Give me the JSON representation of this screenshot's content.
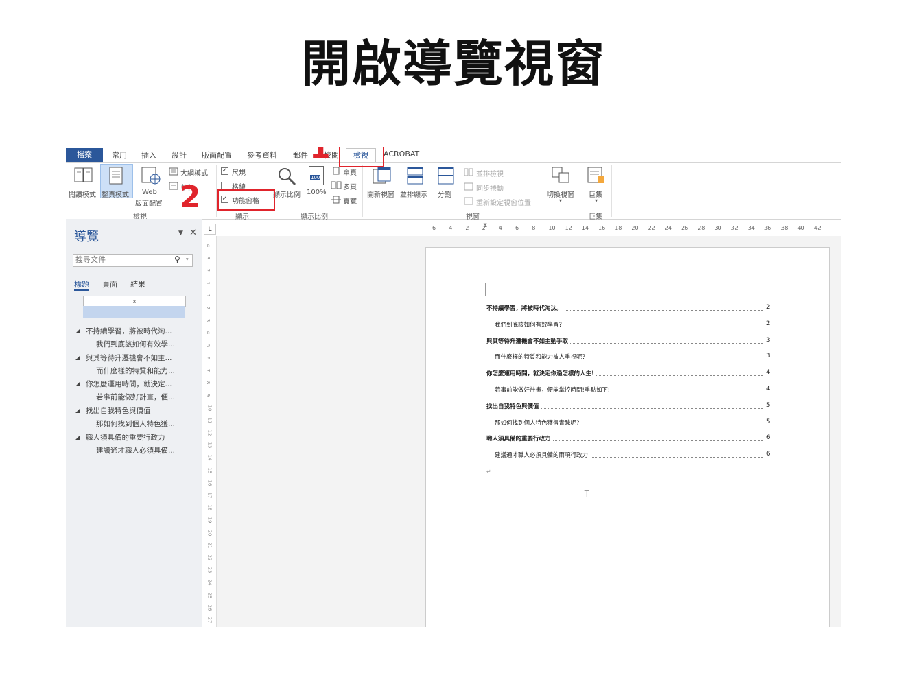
{
  "slide": {
    "title": "開啟導覽視窗"
  },
  "callouts": {
    "step1": "1",
    "step2": "2"
  },
  "tabs": [
    "檔案",
    "常用",
    "插入",
    "設計",
    "版面配置",
    "參考資料",
    "郵件",
    "校閱",
    "檢視",
    "ACROBAT"
  ],
  "ribbon": {
    "views": {
      "read_mode": "閱讀模式",
      "print_layout": "整頁模式",
      "web_layout_1": "Web",
      "web_layout_2": "版面配置",
      "outline": "大綱模式",
      "draft": "草稿",
      "group": "檢視"
    },
    "show": {
      "ruler": "尺規",
      "gridlines": "格線",
      "nav_pane": "功能窗格",
      "group": "顯示"
    },
    "zoom": {
      "zoom": "顯示比例",
      "hundred": "100%",
      "icon_text": "100",
      "one_page": "單頁",
      "multi_page": "多頁",
      "page_width": "頁寬",
      "group": "顯示比例"
    },
    "window": {
      "new_window": "開新視窗",
      "arrange_all": "並排顯示",
      "split": "分割",
      "side_by_side": "並排檢視",
      "sync_scroll": "同步捲動",
      "reset_pos": "重新設定視窗位置",
      "switch": "切換視窗",
      "group": "視窗"
    },
    "macros": {
      "macros": "巨集",
      "group": "巨集"
    }
  },
  "nav": {
    "title": "導覽",
    "search_placeholder": "搜尋文件",
    "tabs": [
      "標題",
      "頁面",
      "結果"
    ],
    "items": [
      {
        "heading": "不持續學習，將被時代淘...",
        "sub": "我們到底該如何有效學..."
      },
      {
        "heading": "與其等待升遷機會不如主...",
        "sub": "而什麼樣的特質和能力..."
      },
      {
        "heading": "你怎麼運用時間，就決定...",
        "sub": "若事前能做好計畫，便..."
      },
      {
        "heading": "找出自我特色與價值",
        "sub": "那如何找到個人特色獲..."
      },
      {
        "heading": "職人須具備的重要行政力",
        "sub": "建議通才職人必須具備..."
      }
    ]
  },
  "ruler": {
    "h": [
      "6",
      "4",
      "2",
      "2",
      "4",
      "6",
      "8",
      "10",
      "12",
      "14",
      "16",
      "18",
      "20",
      "22",
      "24",
      "26",
      "28",
      "30",
      "32",
      "34",
      "36",
      "38",
      "40",
      "42"
    ],
    "v": [
      "4",
      "3",
      "2",
      "1",
      "1",
      "2",
      "3",
      "4",
      "5",
      "6",
      "7",
      "8",
      "9",
      "10",
      "11",
      "12",
      "13",
      "14",
      "15",
      "16",
      "17",
      "18",
      "19",
      "20",
      "21",
      "22",
      "23",
      "24",
      "25",
      "26",
      "27"
    ],
    "corner": "L"
  },
  "toc": [
    {
      "text": "不持續學習，將被時代淘汰。",
      "page": "2",
      "level": 1
    },
    {
      "text": "我們到底該如何有效學習?",
      "page": "2",
      "level": 2
    },
    {
      "text": "與其等待升遷機會不如主動爭取",
      "page": "3",
      "level": 1
    },
    {
      "text": "而什麼樣的特質和能力被人重視呢？",
      "page": "3",
      "level": 2
    },
    {
      "text": "你怎麼運用時間，就決定你過怎樣的人生!",
      "page": "4",
      "level": 1
    },
    {
      "text": "若事前能做好計畫，便能掌控時間!重點如下:",
      "page": "4",
      "level": 2
    },
    {
      "text": "找出自我特色與價值",
      "page": "5",
      "level": 1
    },
    {
      "text": "那如何找到個人特色獲得青睞呢?",
      "page": "5",
      "level": 2
    },
    {
      "text": "職人須具備的重要行政力",
      "page": "6",
      "level": 1
    },
    {
      "text": "建議通才職人必須具備的兩項行政力:",
      "page": "6",
      "level": 2
    }
  ],
  "colors": {
    "accent": "#2b579a",
    "callout": "#e0242c"
  }
}
